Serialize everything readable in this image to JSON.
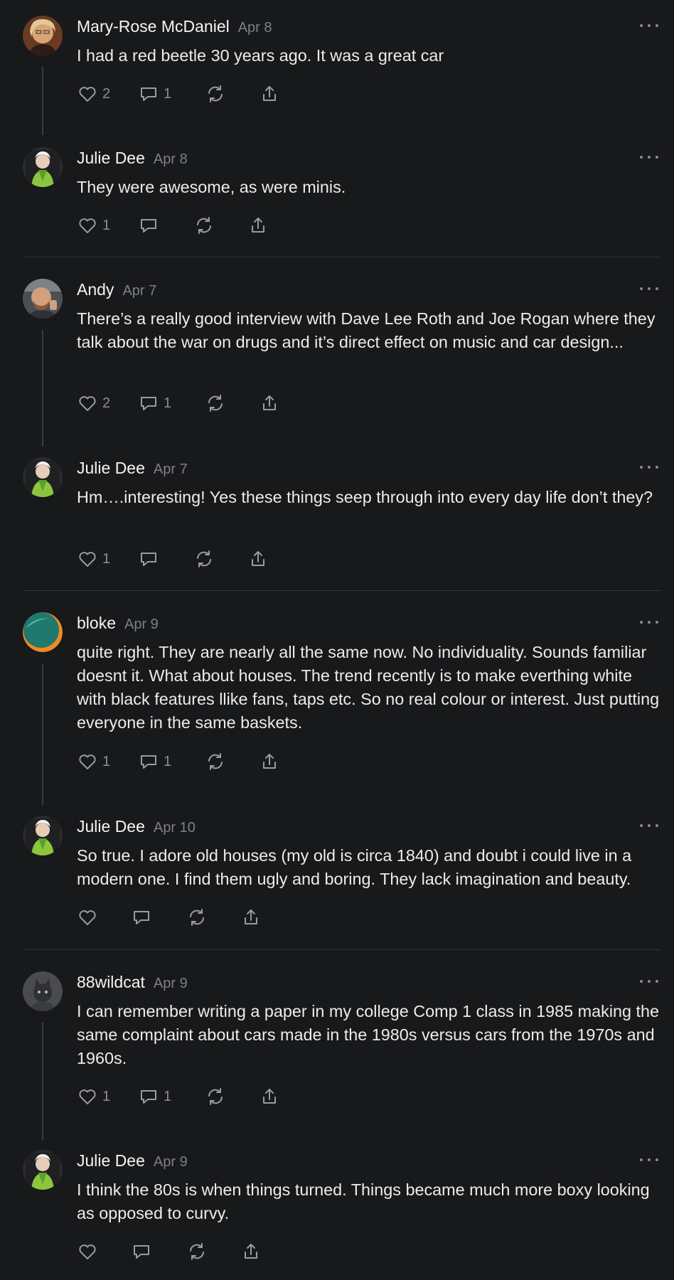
{
  "colors": {
    "background": "#18191b",
    "text": "#f2f2f2",
    "muted": "#7f8084",
    "divider": "#333438"
  },
  "comments": [
    {
      "author": "Mary-Rose McDaniel",
      "date": "Apr 8",
      "text": "I had a red beetle 30 years ago. It was a great car",
      "likes": "2",
      "replies": "1",
      "avatar": "avatar-photo-woman-blonde"
    },
    {
      "author": "Julie Dee",
      "date": "Apr 8",
      "text": "They were awesome, as were minis.",
      "likes": "1",
      "replies": "",
      "avatar": "avatar-photo-woman-green-scarf"
    },
    {
      "author": "Andy",
      "date": "Apr 7",
      "text": "There’s a really good interview with Dave Lee Roth and Joe Rogan where they talk about the war on drugs and it’s direct effect on music and car design...",
      "likes": "2",
      "replies": "1",
      "avatar": "avatar-photo-man-beard"
    },
    {
      "author": "Julie Dee",
      "date": "Apr 7",
      "text": "Hm….interesting! Yes these things seep through into every day life don’t they?",
      "likes": "1",
      "replies": "",
      "avatar": "avatar-photo-woman-green-scarf"
    },
    {
      "author": "bloke",
      "date": "Apr 9",
      "text": "quite right. They are nearly all the same now. No individuality. Sounds familiar doesnt it. What about houses. The trend recently is to make everthing white with black features llike fans, taps etc. So no real colour or interest. Just putting everyone in the same baskets.",
      "likes": "1",
      "replies": "1",
      "avatar": "avatar-graphic-teal-orange"
    },
    {
      "author": "Julie Dee",
      "date": "Apr 10",
      "text": "So true. I adore old houses (my old is circa 1840) and doubt i could live in a modern one. I find them ugly and boring. They lack imagination and beauty.",
      "likes": "",
      "replies": "",
      "avatar": "avatar-photo-woman-green-scarf"
    },
    {
      "author": "88wildcat",
      "date": "Apr 9",
      "text": "I can remember writing a paper in my college Comp 1 class in 1985 making the same complaint about cars made in the 1980s versus cars from the 1970s and 1960s.",
      "likes": "1",
      "replies": "1",
      "avatar": "avatar-photo-grey-cat"
    },
    {
      "author": "Julie Dee",
      "date": "Apr 9",
      "text": "I think the 80s is when things turned. Things became much more boxy looking as opposed to curvy.",
      "likes": "",
      "replies": "",
      "avatar": "avatar-photo-woman-green-scarf"
    }
  ]
}
